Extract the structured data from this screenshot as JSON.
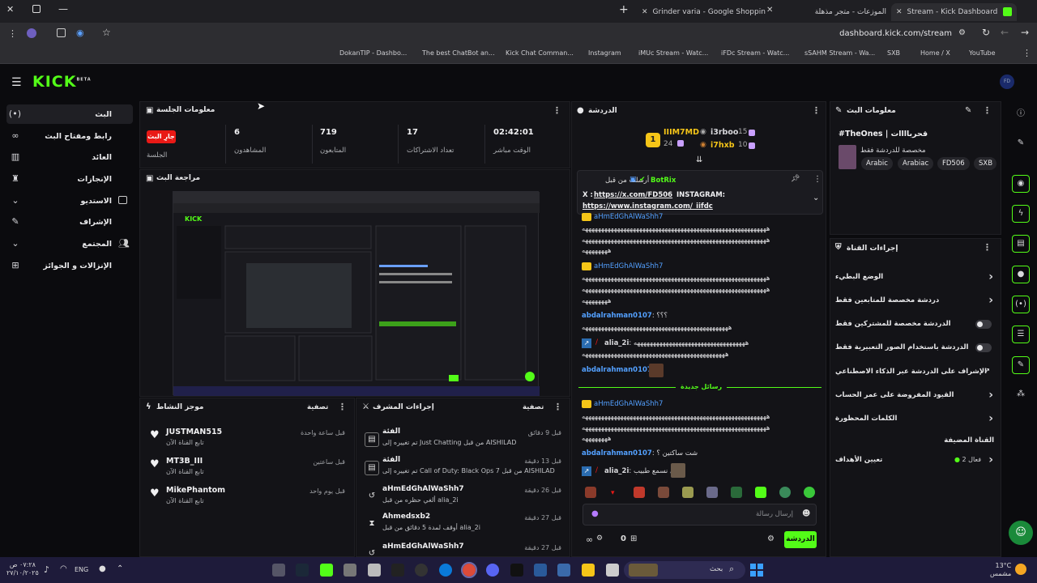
{
  "browser": {
    "tabs": [
      {
        "label": "Grinder varia - Google Shoppin"
      },
      {
        "label": "الموزعات - متجر مذهلة"
      },
      {
        "label": "Stream - Kick Dashboard"
      }
    ],
    "url": "dashboard.kick.com/stream",
    "bookmarks": [
      "DokanTIP - Dashbo...",
      "The best ChatBot an...",
      "Kick Chat Comman...",
      "Instagram",
      "iMUc Stream - Watc...",
      "iFDc Stream - Watc...",
      "sSAHM Stream - Wa...",
      "SXB",
      "Home / X",
      "YouTube"
    ]
  },
  "logo": {
    "text": "KICK",
    "beta": "BETA"
  },
  "sidebar": {
    "items": [
      {
        "label": "البث",
        "icon": "live-icon"
      },
      {
        "label": "رابط ومفتاح البث",
        "icon": "link-icon"
      },
      {
        "label": "العائد",
        "icon": "building-icon"
      },
      {
        "label": "الإنجازات",
        "icon": "trophy-icon"
      },
      {
        "label": "الاستديو",
        "icon": "chevron-down-icon"
      },
      {
        "label": "الإشراف",
        "icon": "wrench-icon"
      },
      {
        "label": "المجتمع",
        "icon": "chevron-down-icon"
      },
      {
        "label": "الإنزالات و الجوائز",
        "icon": "gift-icon"
      }
    ]
  },
  "session": {
    "title": "معلومات الجلسة",
    "live_badge": "جارِ البث",
    "stats": [
      {
        "value": "02:42:01",
        "label": "الوقت مباشر"
      },
      {
        "value": "17",
        "label": "تعداد الاشتراكات"
      },
      {
        "value": "719",
        "label": "المتابعون"
      },
      {
        "value": "6",
        "label": "المشاهدون"
      },
      {
        "value": "",
        "label": "الجلسة"
      }
    ]
  },
  "preview": {
    "title": "مراجعة البث"
  },
  "feed": {
    "title": "موجز النشاط",
    "filter": "تصفية",
    "items": [
      {
        "name": "JUSTMAN515",
        "sub": "تابع القناة الآن",
        "time": "قبل ساعة واحدة"
      },
      {
        "name": "MT3B_III",
        "sub": "تابع القناة الآن",
        "time": "قبل ساعتين"
      },
      {
        "name": "MikePhantom",
        "sub": "تابع القناة الآن",
        "time": "قبل يوم واحد"
      }
    ]
  },
  "mod_actions": {
    "title": "إجراءات المشرف",
    "filter": "تصفية",
    "items": [
      {
        "title": "الفئة",
        "sub": "تم تغييره إلى Just Chatting من قبل AISHILAD",
        "time": "قبل 9 دقائق"
      },
      {
        "title": "الفئة",
        "sub": "تم تغييره إلى Call of Duty: Black Ops 7 من قبل AISHILAD",
        "time": "قبل 13 دقيقة"
      },
      {
        "title": "aHmEdGhAlWaShh7",
        "sub": "ألغي حظره من قبل alia_2i",
        "time": "قبل 26 دقيقة"
      },
      {
        "title": "Ahmedsxb2",
        "sub": "أوقف لمدة 5 دقائق من قبل alia_2i",
        "time": "قبل 27 دقيقة"
      },
      {
        "title": "aHmEdGhAlWaShh7",
        "sub": "",
        "time": "قبل 27 دقيقة"
      }
    ]
  },
  "chat": {
    "title": "الدردشة",
    "leaders": [
      {
        "name": "IIIM7MD",
        "value": "24"
      },
      {
        "name": "i3rboo",
        "value": "15"
      },
      {
        "name": "i7hxb",
        "value": "10"
      }
    ],
    "pinned": {
      "sender_prefix": "أرسلت من قبل",
      "sender": "BotRix",
      "line1_prefix": "X :",
      "line1_link": "https://x.com/FD506",
      "line1_suffix": "INSTAGRAM:",
      "line2_link": "https://www.instagram.com/_iifdc"
    },
    "messages": [
      {
        "user": "aHmEdGhAlWaShh7",
        "text": ""
      },
      {
        "user": "",
        "text": "ههههههههههههههههههههههههههههههههههههههههههههههههههههههههههه"
      },
      {
        "user": "",
        "text": "ههههههههههههههههههههههههههههههههههههههههههههههههههههههههههه"
      },
      {
        "user": "aHmEdGhAlWaShh7",
        "text": ""
      },
      {
        "user": "",
        "text": "ههههههههههههههههههههههههههههههههههههههههههههههههههههههههههه"
      },
      {
        "user": "",
        "text": "ههههههههههههههههههههههههههههههههههههههههههههههههههههههههههه"
      },
      {
        "user": "abdalrahman0107",
        "text": "؟؟؟"
      },
      {
        "user": "",
        "text": "ههههههههههههههههههههههههههههههههههههههههههههههه"
      },
      {
        "user": "alia_2i",
        "text": "هههههههههههههههههههههههههههههههههههه"
      },
      {
        "user": "",
        "text": "هههههههههههههههههههههههههههههههههههههههههههههه"
      },
      {
        "user": "abdalrahman0107",
        "text": ""
      },
      {
        "user": "aHmEdGhAlWaShh7",
        "text": ""
      },
      {
        "user": "",
        "text": "ههههههههههههههههههههههههههههههههههههههههههههههههههههههههههه"
      },
      {
        "user": "",
        "text": "ههههههههههههههههههههههههههههههههههههههههههههههههههههههههههه"
      },
      {
        "user": "abdalrahman0107",
        "text": "شت ساكتين ؟"
      },
      {
        "user": "alia_2i",
        "text": "اني نسمع طبيب"
      }
    ],
    "new_messages": "رسائل جديدة",
    "input_placeholder": "إرسال رسالة",
    "send_label": "الدردشة",
    "viewer_count": "0"
  },
  "stream_info": {
    "title": "معلومات البث",
    "stream_title": "#TheOnes | قحرباااات",
    "subtitle": "مخصصة للدردشة فقط",
    "tags": [
      "Arabic",
      "Arabiac",
      "FD506",
      "SXB"
    ]
  },
  "channel_actions": {
    "title": "إجراءات القناة",
    "items": [
      {
        "label": "الوضع البطيء",
        "type": "chevron"
      },
      {
        "label": "دردشة مخصصة للمتابعين فقط",
        "type": "chevron"
      },
      {
        "label": "الدردشة مخصصة للمشتركين فقط",
        "type": "toggle"
      },
      {
        "label": "الدردشة باستخدام الصور التعبيرية فقط",
        "type": "toggle"
      },
      {
        "label": "الإشراف على الدردشة عبر الذكاء الاصطناعي",
        "type": "external"
      },
      {
        "label": "القيود المفروضة على عمر الحساب",
        "type": "chevron"
      },
      {
        "label": "الكلمات المحظورة",
        "type": "chevron"
      },
      {
        "label": "القناة المضيفة",
        "type": "none"
      },
      {
        "label": "تعيين الأهداف",
        "type": "chevron",
        "status": "فعال 2"
      }
    ]
  },
  "taskbar": {
    "time": "٠٧:٢٨ ص",
    "date": "٢٧/١٠/٢٠٢٥",
    "lang": "ENG",
    "search_placeholder": "بحث",
    "weather_temp": "13°C",
    "weather_text": "مشمس"
  },
  "colors": {
    "accent": "#53fc18",
    "live": "#e91916",
    "bg": "#0b0b0e",
    "panel": "#131317"
  }
}
